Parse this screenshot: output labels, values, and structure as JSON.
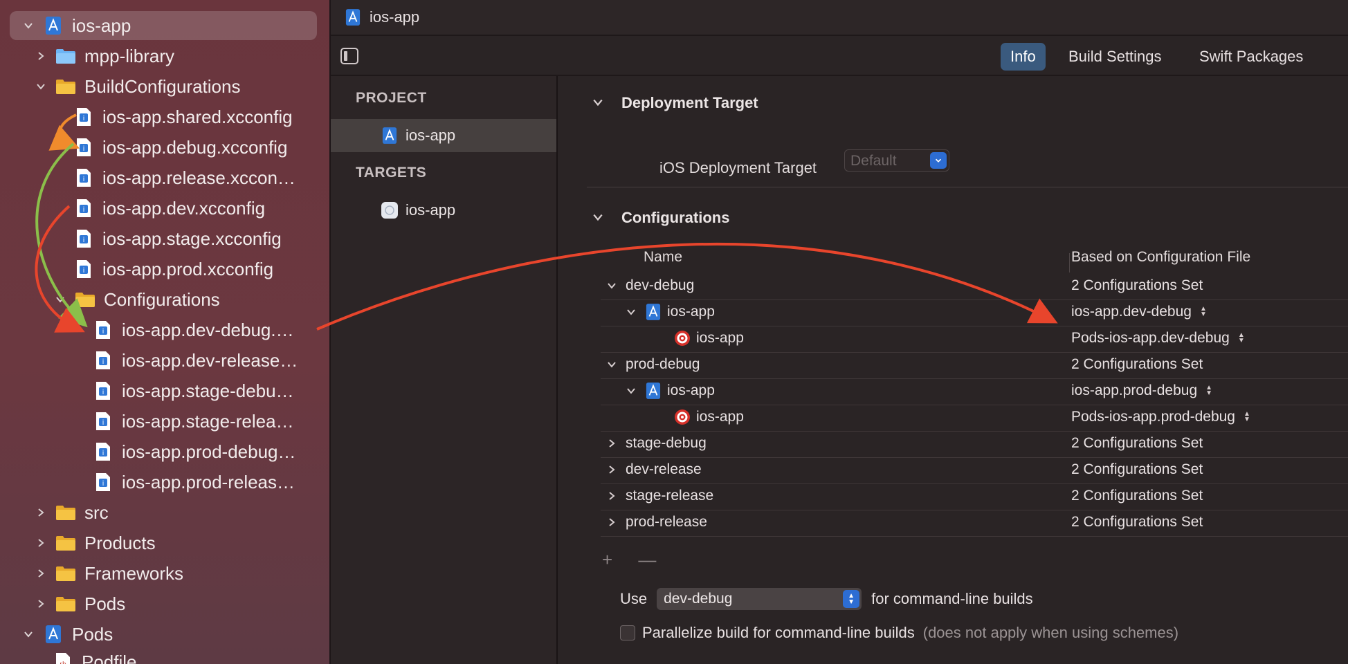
{
  "colors": {
    "navigator_bg": "#6a353d",
    "accent_blue": "#2d6dd3",
    "tab_active": "#3a5a7e",
    "arrow_red": "#e8452c",
    "arrow_orange": "#f08b2c",
    "arrow_green": "#8bbf4a",
    "folder_yellow": "#f5c343",
    "xcconfig_blue": "#2f77d6"
  },
  "navigator": {
    "root": "ios-app",
    "items": [
      {
        "label": "mpp-library",
        "icon": "folder-blue-icon"
      },
      {
        "label": "BuildConfigurations",
        "icon": "folder-icon"
      },
      {
        "label": "ios-app.shared.xcconfig",
        "icon": "xcconfig-file-icon"
      },
      {
        "label": "ios-app.debug.xcconfig",
        "icon": "xcconfig-file-icon"
      },
      {
        "label": "ios-app.release.xccon…",
        "icon": "xcconfig-file-icon"
      },
      {
        "label": "ios-app.dev.xcconfig",
        "icon": "xcconfig-file-icon"
      },
      {
        "label": "ios-app.stage.xcconfig",
        "icon": "xcconfig-file-icon"
      },
      {
        "label": "ios-app.prod.xcconfig",
        "icon": "xcconfig-file-icon"
      },
      {
        "label": "Configurations",
        "icon": "folder-icon"
      },
      {
        "label": "ios-app.dev-debug.…",
        "icon": "xcconfig-file-icon"
      },
      {
        "label": "ios-app.dev-release…",
        "icon": "xcconfig-file-icon"
      },
      {
        "label": "ios-app.stage-debu…",
        "icon": "xcconfig-file-icon"
      },
      {
        "label": "ios-app.stage-relea…",
        "icon": "xcconfig-file-icon"
      },
      {
        "label": "ios-app.prod-debug…",
        "icon": "xcconfig-file-icon"
      },
      {
        "label": "ios-app.prod-releas…",
        "icon": "xcconfig-file-icon"
      },
      {
        "label": "src",
        "icon": "folder-icon"
      },
      {
        "label": "Products",
        "icon": "folder-icon"
      },
      {
        "label": "Frameworks",
        "icon": "folder-icon"
      },
      {
        "label": "Pods",
        "icon": "folder-icon"
      },
      {
        "label": "Pods",
        "icon": "project-icon"
      },
      {
        "label": "Podfile",
        "icon": "podfile-icon"
      }
    ]
  },
  "jumpbar": {
    "crumb": "ios-app"
  },
  "tabs": [
    {
      "label": "Info",
      "active": true
    },
    {
      "label": "Build Settings",
      "active": false
    },
    {
      "label": "Swift Packages",
      "active": false
    }
  ],
  "target_list": {
    "project_header": "PROJECT",
    "project_item": "ios-app",
    "targets_header": "TARGETS",
    "target_item": "ios-app"
  },
  "deployment": {
    "title": "Deployment Target",
    "label": "iOS Deployment Target",
    "value": "Default"
  },
  "configurations": {
    "title": "Configurations",
    "col_name": "Name",
    "col_base": "Based on Configuration File",
    "rows": [
      {
        "name": "dev-debug",
        "base": "2 Configurations Set"
      },
      {
        "name": "ios-app",
        "base": "ios-app.dev-debug"
      },
      {
        "name": "ios-app",
        "base": "Pods-ios-app.dev-debug"
      },
      {
        "name": "prod-debug",
        "base": "2 Configurations Set"
      },
      {
        "name": "ios-app",
        "base": "ios-app.prod-debug"
      },
      {
        "name": "ios-app",
        "base": "Pods-ios-app.prod-debug"
      },
      {
        "name": "stage-debug",
        "base": "2 Configurations Set"
      },
      {
        "name": "dev-release",
        "base": "2 Configurations Set"
      },
      {
        "name": "stage-release",
        "base": "2 Configurations Set"
      },
      {
        "name": "prod-release",
        "base": "2 Configurations Set"
      }
    ],
    "add_symbol": "+",
    "remove_symbol": "—"
  },
  "use_row": {
    "prefix": "Use",
    "value": "dev-debug",
    "suffix": "for command-line builds"
  },
  "parallel_row": {
    "label": "Parallelize build for command-line builds",
    "note": "(does not apply when using schemes)",
    "checked": false
  }
}
